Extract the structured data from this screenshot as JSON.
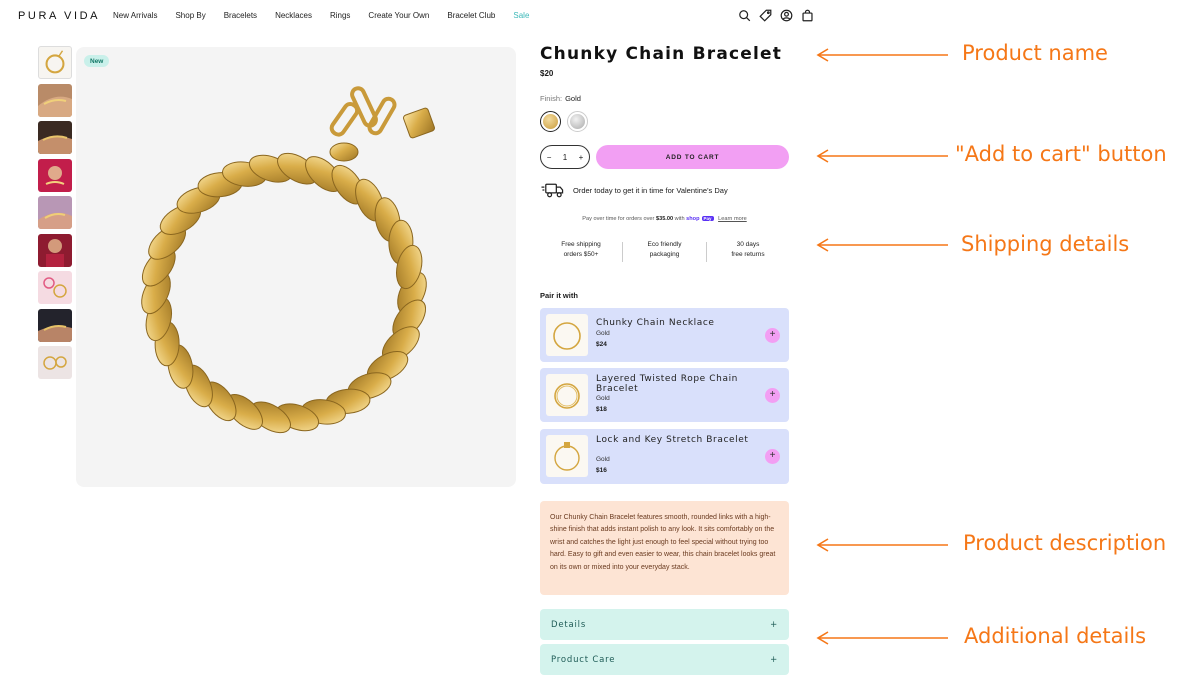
{
  "header": {
    "logo": "PURA VIDA",
    "nav": [
      "New Arrivals",
      "Shop By",
      "Bracelets",
      "Necklaces",
      "Rings",
      "Create Your Own",
      "Bracelet Club",
      "Sale"
    ],
    "icons": [
      "search-icon",
      "tag-icon",
      "account-icon",
      "bag-icon"
    ]
  },
  "gallery": {
    "badge": "New",
    "thumbnail_count": 9
  },
  "product": {
    "title": "Chunky Chain Bracelet",
    "price": "$20",
    "finish_label": "Finish:",
    "finish_value": "Gold",
    "swatches": [
      "gold",
      "silver"
    ],
    "qty": "1",
    "qty_minus": "−",
    "qty_plus": "+",
    "add_to_cart": "ADD TO CART",
    "shipping_note": "Order today to get it in time for Valentine's Day",
    "pay_prefix": "Pay over time for orders over",
    "pay_amount": "$35.00",
    "pay_with": "with",
    "pay_shop": "shop",
    "pay_badge": "Pay",
    "pay_link": "Learn more",
    "perks": [
      {
        "line1": "Free shipping",
        "line2": "orders $50+"
      },
      {
        "line1": "Eco friendly",
        "line2": "packaging"
      },
      {
        "line1": "30 days",
        "line2": "free returns"
      }
    ]
  },
  "pair": {
    "heading": "Pair it with",
    "items": [
      {
        "name": "Chunky Chain Necklace",
        "finish": "Gold",
        "price": "$24"
      },
      {
        "name": "Layered Twisted Rope Chain Bracelet",
        "finish": "Gold",
        "price": "$18"
      },
      {
        "name": "Lock and Key Stretch Bracelet",
        "finish": "Gold",
        "price": "$16"
      }
    ],
    "add": "+"
  },
  "description": "Our Chunky Chain Bracelet features smooth, rounded links with a high-shine finish that adds instant polish to any look. It sits comfortably on the wrist and catches the light just enough to feel special without trying too hard. Easy to gift and even easier to wear, this chain bracelet looks great on its own or mixed into your everyday stack.",
  "accordions": [
    {
      "label": "Details",
      "icon": "+"
    },
    {
      "label": "Product Care",
      "icon": "+"
    }
  ],
  "annotations": {
    "product_name": "Product name",
    "add_to_cart": "\"Add to cart\" button",
    "shipping": "Shipping details",
    "description": "Product description",
    "additional": "Additional details"
  },
  "colors": {
    "annotation": "#f57717",
    "add_to_cart_bg": "#f29ff3",
    "pair_card_bg": "#d9e0fb",
    "description_bg": "#fde4d4",
    "accordion_bg": "#d4f3ed",
    "sale": "#3bb8b8",
    "gold": "#d8b04e"
  }
}
